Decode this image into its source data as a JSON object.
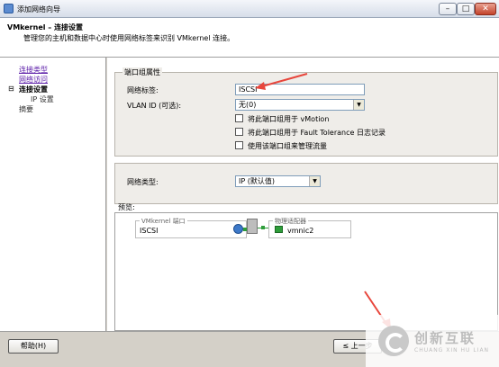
{
  "window": {
    "title": "添加网络向导",
    "buttons": {
      "minimize": "–",
      "maximize": "□",
      "close": "✕"
    }
  },
  "header": {
    "title": "VMkernel – 连接设置",
    "subtitle": "管理您的主机和数据中心时使用网络标签来识别 VMkernel 连接。"
  },
  "nav": {
    "items": [
      {
        "label": "连接类型"
      },
      {
        "label": "网络访问"
      },
      {
        "label": "连接设置"
      },
      {
        "label": "IP 设置"
      },
      {
        "label": "摘要"
      }
    ]
  },
  "port_group": {
    "legend": "端口组属性",
    "network_label_label": "网络标签:",
    "network_label_value": "ISCSI",
    "vlan_label": "VLAN ID (可选):",
    "vlan_value": "无(0)",
    "checkboxes": [
      {
        "label": "将此端口组用于 vMotion",
        "checked": false
      },
      {
        "label": "将此端口组用于 Fault Tolerance 日志记录",
        "checked": false
      },
      {
        "label": "使用该端口组来管理流量",
        "checked": false
      }
    ]
  },
  "network_type": {
    "label": "网络类型:",
    "value": "IP (默认值)"
  },
  "preview": {
    "label": "预览:",
    "vmkernel_legend": "VMkernel 端口",
    "port_name": "ISCSI",
    "adapter_legend": "物理适配器",
    "adapter_name": "vmnic2"
  },
  "footer": {
    "help_label": "帮助(H)",
    "back_label": "≤ 上一步"
  },
  "watermark": {
    "text": "创新互联",
    "sub": "CHUANG XIN HU LIAN"
  },
  "colors": {
    "arrow": "#e8463c",
    "link": "#5b1ca8"
  }
}
